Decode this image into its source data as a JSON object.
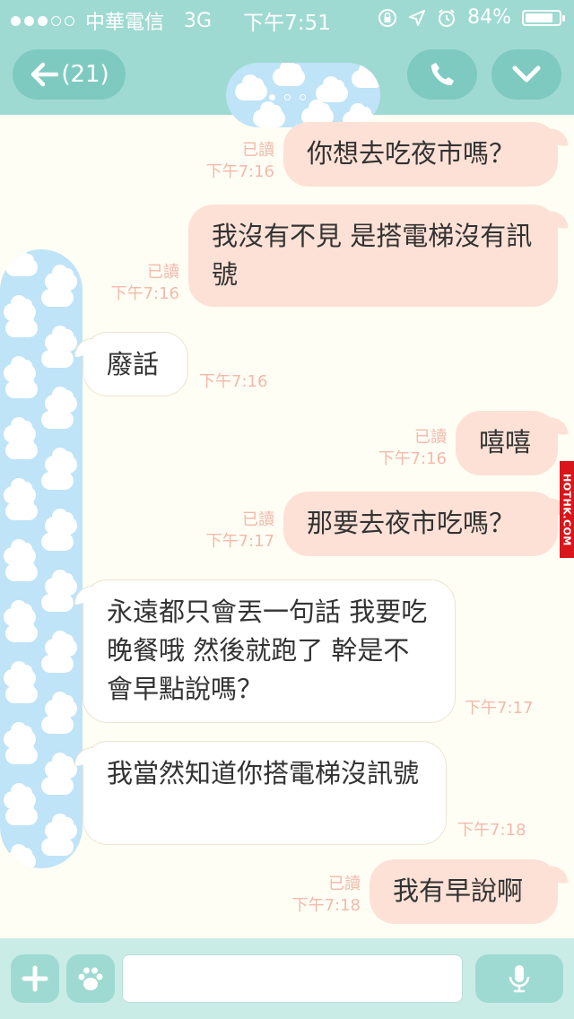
{
  "status_bar": {
    "signal_dots_filled": 3,
    "signal_dots_total": 5,
    "carrier": "中華電信",
    "network": "3G",
    "time": "下午7:51",
    "battery": "84%",
    "battery_level": 0.84,
    "icons": [
      "rotation-lock-icon",
      "location-arrow-icon",
      "alarm-icon",
      "battery-icon"
    ]
  },
  "header": {
    "back_label": "(21)",
    "back_icon": "arrow-left-icon",
    "call_icon": "phone-icon",
    "menu_icon": "chevron-down-icon",
    "page_dots": 3,
    "active_page": 0
  },
  "messages": [
    {
      "dir": "out",
      "text": "你想去吃夜市嗎？",
      "read": "已讀",
      "time": "下午7:16"
    },
    {
      "dir": "out",
      "text": "我沒有不見 是搭電梯沒有訊號",
      "read": "已讀",
      "time": "下午7:16"
    },
    {
      "dir": "in",
      "text": "廢話",
      "time": "下午7:16"
    },
    {
      "dir": "out",
      "text": "嘻嘻",
      "read": "已讀",
      "time": "下午7:16"
    },
    {
      "dir": "out",
      "text": "那要去夜市吃嗎？",
      "read": "已讀",
      "time": "下午7:17"
    },
    {
      "dir": "in",
      "text": "永遠都只會丟一句話 我要吃晚餐哦 然後就跑了 幹是不會早點說嗎？",
      "time": "下午7:17"
    },
    {
      "dir": "in",
      "text": "我當然知道你搭電梯沒訊號",
      "time": "下午7:18"
    },
    {
      "dir": "out",
      "text": "我有早說啊",
      "read": "已讀",
      "time": "下午7:18"
    }
  ],
  "input_bar": {
    "plus_icon": "plus-icon",
    "sticker_icon": "paw-icon",
    "message_value": "",
    "mic_icon": "microphone-icon"
  },
  "watermark": "HOTHK.COM",
  "colors": {
    "header_bg": "#9fdad2",
    "button_bg": "#7ecac0",
    "outgoing_bubble": "#fde1d6",
    "incoming_bubble": "#ffffff",
    "chat_bg": "#fffef4",
    "meta_text": "#f3b9ab",
    "cloud_bg": "#bfe3f7"
  }
}
